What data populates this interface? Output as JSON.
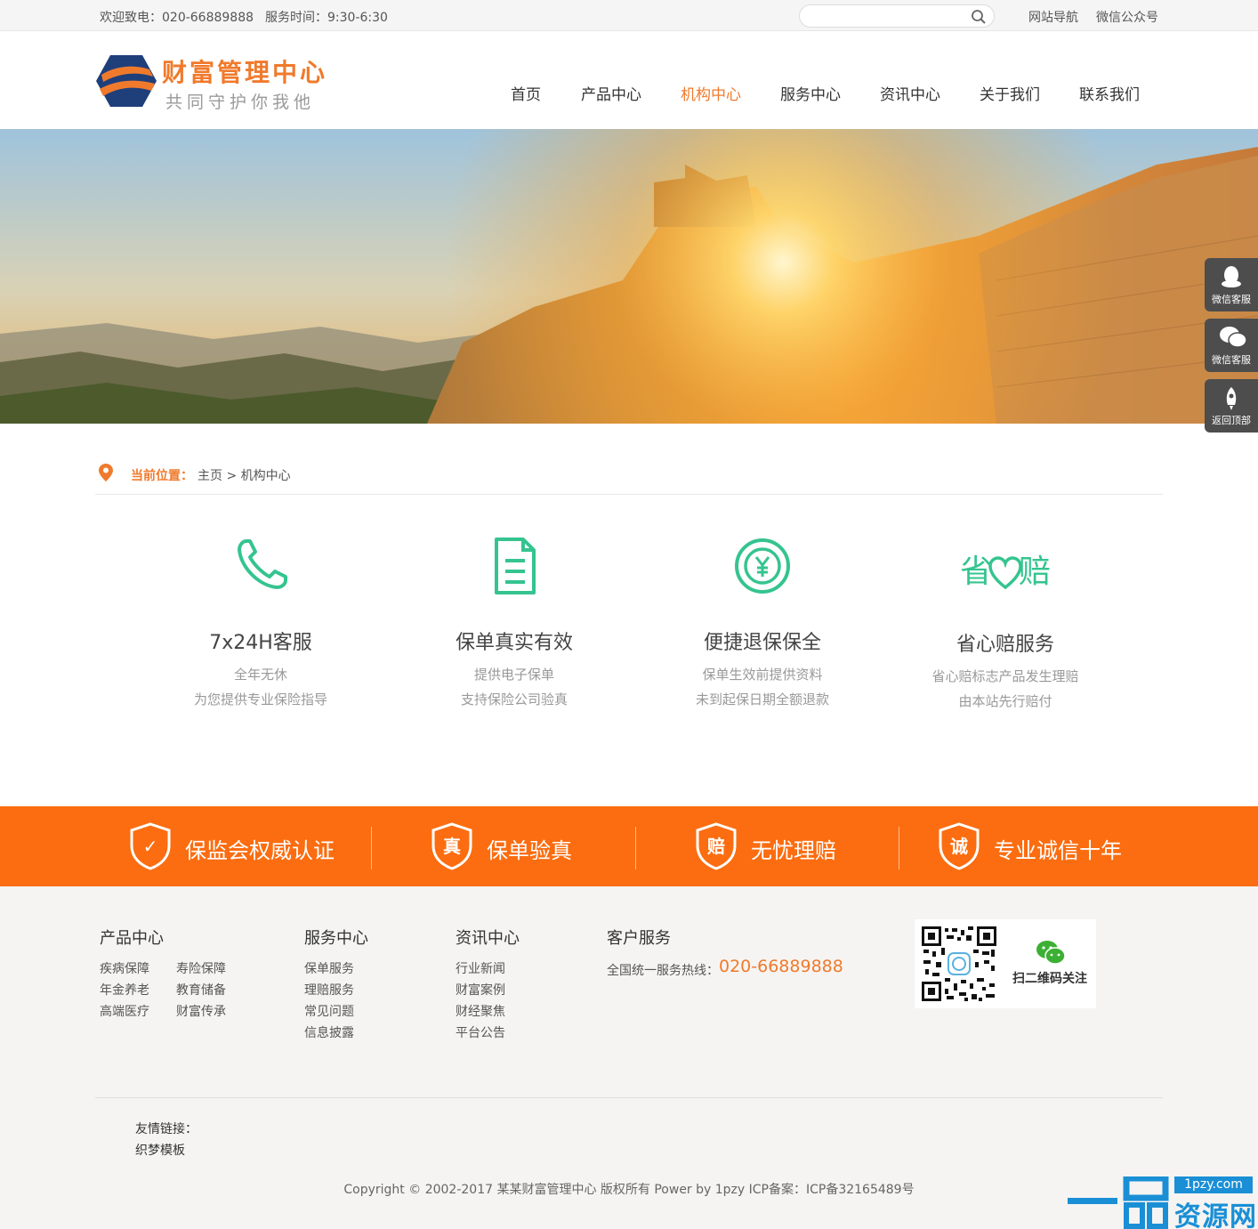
{
  "topbar": {
    "welcome": "欢迎致电：020-66889888",
    "hours": "服务时间：9:30-6:30",
    "search_placeholder": "",
    "links": [
      "网站导航",
      "微信公众号"
    ]
  },
  "header": {
    "logo_title": "财富管理中心",
    "logo_slogan": "共同守护你我他",
    "nav": [
      "首页",
      "产品中心",
      "机构中心",
      "服务中心",
      "资讯中心",
      "关于我们",
      "联系我们"
    ],
    "active_nav": "机构中心"
  },
  "float_sidebar": [
    "微信客服",
    "微信客服",
    "返回顶部"
  ],
  "breadcrumb": {
    "label": "当前位置：",
    "path": "主页 > 机构中心"
  },
  "features": [
    {
      "icon": "phone-icon",
      "title": "7x24H客服",
      "lines": [
        "全年无休",
        "为您提供专业保险指导"
      ]
    },
    {
      "icon": "document-icon",
      "title": "保单真实有效",
      "lines": [
        "提供电子保单",
        "支持保险公司验真"
      ]
    },
    {
      "icon": "yen-coin-icon",
      "title": "便捷退保保全",
      "lines": [
        "保单生效前提供资料",
        "未到起保日期全额退款"
      ]
    },
    {
      "icon": "heart-claim-icon",
      "icon_text": [
        "省",
        "赔"
      ],
      "title": "省心赔服务",
      "lines": [
        "省心赔标志产品发生理赔",
        "由本站先行赔付"
      ]
    }
  ],
  "strip": [
    {
      "badge": "✓",
      "text": "保监会权威认证"
    },
    {
      "badge": "真",
      "text": "保单验真"
    },
    {
      "badge": "赔",
      "text": "无忧理赔"
    },
    {
      "badge": "诚",
      "text": "专业诚信十年"
    }
  ],
  "footer": {
    "products": {
      "title": "产品中心",
      "links": [
        "疾病保障",
        "寿险保障",
        "年金养老",
        "教育储备",
        "高端医疗",
        "财富传承"
      ]
    },
    "services": {
      "title": "服务中心",
      "links": [
        "保单服务",
        "理赔服务",
        "常见问题",
        "信息披露"
      ]
    },
    "news": {
      "title": "资讯中心",
      "links": [
        "行业新闻",
        "财富案例",
        "财经聚焦",
        "平台公告"
      ]
    },
    "customer": {
      "title": "客户服务",
      "hotline_label": "全国统一服务热线：",
      "hotline": "020-66889888"
    },
    "qr_text": "扫二维码关注",
    "friend_label": "友情链接：",
    "friend_link": "织梦模板",
    "copyright": "Copyright © 2002-2017 某某财富管理中心 版权所有 Power by 1pzy ICP备案：ICP备32165489号"
  },
  "watermark": {
    "url": "1pzy.com",
    "name": "资源网"
  },
  "colors": {
    "accent": "#f07a2c",
    "strip": "#fb6d10",
    "feature_icon": "#35c48f",
    "sidebar": "#4d4d4d"
  }
}
